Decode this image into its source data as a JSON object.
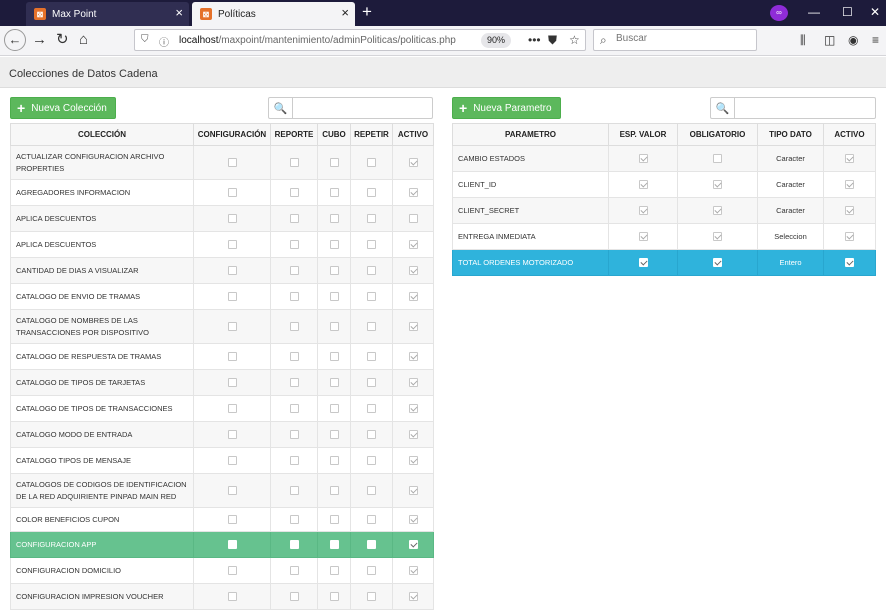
{
  "browser": {
    "tabs": [
      {
        "title": "Max Point",
        "active": false
      },
      {
        "title": "Políticas",
        "active": true
      }
    ],
    "url_host": "localhost",
    "url_path": "/maxpoint/mantenimiento/adminPoliticas/politicas.php",
    "zoom": "90%",
    "search_placeholder": "Buscar"
  },
  "page": {
    "title": "Colecciones de Datos Cadena",
    "colecciones": {
      "add_button": "Nueva Colección",
      "headers": [
        "COLECCIÓN",
        "CONFIGURACIÓN",
        "REPORTE",
        "CUBO",
        "REPETIR",
        "ACTIVO"
      ],
      "rows": [
        {
          "name": "ACTUALIZAR CONFIGURACION ARCHIVO PROPERTIES",
          "flags": [
            false,
            false,
            false,
            false,
            true
          ]
        },
        {
          "name": "AGREGADORES INFORMACION",
          "flags": [
            false,
            false,
            false,
            false,
            true
          ]
        },
        {
          "name": "APLICA DESCUENTOS",
          "flags": [
            false,
            false,
            false,
            false,
            false
          ]
        },
        {
          "name": "APLICA DESCUENTOS",
          "flags": [
            false,
            false,
            false,
            false,
            true
          ]
        },
        {
          "name": "CANTIDAD DE DIAS A VISUALIZAR",
          "flags": [
            false,
            false,
            false,
            false,
            true
          ]
        },
        {
          "name": "CATALOGO DE ENVIO DE TRAMAS",
          "flags": [
            false,
            false,
            false,
            false,
            true
          ]
        },
        {
          "name": "CATALOGO DE NOMBRES DE LAS TRANSACCIONES POR DISPOSITIVO",
          "flags": [
            false,
            false,
            false,
            false,
            true
          ]
        },
        {
          "name": "CATALOGO DE RESPUESTA DE TRAMAS",
          "flags": [
            false,
            false,
            false,
            false,
            true
          ]
        },
        {
          "name": "CATALOGO DE TIPOS DE TARJETAS",
          "flags": [
            false,
            false,
            false,
            false,
            true
          ]
        },
        {
          "name": "CATALOGO DE TIPOS DE TRANSACCIONES",
          "flags": [
            false,
            false,
            false,
            false,
            true
          ]
        },
        {
          "name": "CATALOGO MODO DE ENTRADA",
          "flags": [
            false,
            false,
            false,
            false,
            true
          ]
        },
        {
          "name": "CATALOGO TIPOS DE MENSAJE",
          "flags": [
            false,
            false,
            false,
            false,
            true
          ]
        },
        {
          "name": "CATALOGOS DE CODIGOS DE IDENTIFICACION DE LA RED ADQUIRIENTE PINPAD MAIN RED",
          "flags": [
            false,
            false,
            false,
            false,
            true
          ]
        },
        {
          "name": "COLOR BENEFICIOS CUPON",
          "flags": [
            false,
            false,
            false,
            false,
            true
          ]
        },
        {
          "name": "CONFIGURACION APP",
          "flags": [
            false,
            false,
            false,
            false,
            true
          ],
          "selected": true
        },
        {
          "name": "CONFIGURACION DOMICILIO",
          "flags": [
            false,
            false,
            false,
            false,
            true
          ]
        },
        {
          "name": "CONFIGURACION IMPRESION VOUCHER",
          "flags": [
            false,
            false,
            false,
            false,
            true
          ]
        }
      ]
    },
    "parametros": {
      "add_button": "Nueva Parametro",
      "headers": [
        "PARAMETRO",
        "ESP. VALOR",
        "OBLIGATORIO",
        "TIPO DATO",
        "ACTIVO"
      ],
      "rows": [
        {
          "name": "CAMBIO ESTADOS",
          "esp_valor": true,
          "obligatorio": false,
          "tipo": "Caracter",
          "activo": true
        },
        {
          "name": "CLIENT_ID",
          "esp_valor": true,
          "obligatorio": true,
          "tipo": "Caracter",
          "activo": true
        },
        {
          "name": "CLIENT_SECRET",
          "esp_valor": true,
          "obligatorio": true,
          "tipo": "Caracter",
          "activo": true
        },
        {
          "name": "ENTREGA INMEDIATA",
          "esp_valor": true,
          "obligatorio": true,
          "tipo": "Seleccion",
          "activo": true
        },
        {
          "name": "TOTAL ORDENES MOTORIZADO",
          "esp_valor": true,
          "obligatorio": true,
          "tipo": "Entero",
          "activo": true,
          "selected": true
        }
      ]
    }
  },
  "colors": {
    "selected_green": "#66c28f",
    "selected_blue": "#2fb3dc",
    "button_green": "#5cb85c"
  }
}
